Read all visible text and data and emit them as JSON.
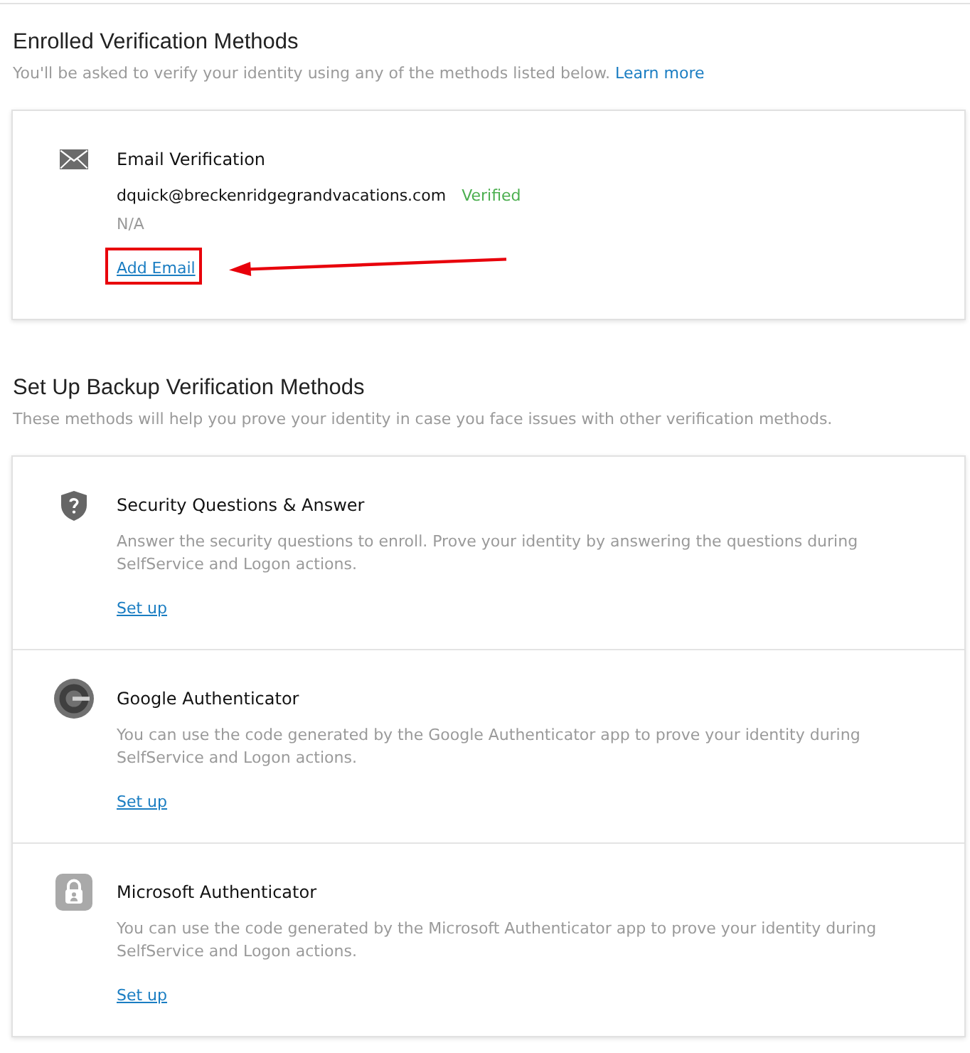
{
  "enrolled": {
    "title": "Enrolled Verification Methods",
    "subtitle": "You'll be asked to verify your identity using any of the methods listed below.",
    "learn_more": "Learn more",
    "methods": [
      {
        "kind": "email",
        "title": "Email Verification",
        "value": "dquick@breckenridgegrandvacations.com",
        "status": "Verified",
        "note": "N/A",
        "action": "Add Email",
        "highlighted": true
      }
    ]
  },
  "backup": {
    "title": "Set Up Backup Verification Methods",
    "subtitle": "These methods will help you prove your identity in case you face issues with other verification methods.",
    "methods": [
      {
        "kind": "security-questions",
        "title": "Security Questions & Answer",
        "description": "Answer the security questions to enroll. Prove your identity by answering the questions during SelfService and Logon actions.",
        "action": "Set up"
      },
      {
        "kind": "google-authenticator",
        "title": "Google Authenticator",
        "description": "You can use the code generated by the Google Authenticator app to prove your identity during SelfService and Logon actions.",
        "action": "Set up"
      },
      {
        "kind": "microsoft-authenticator",
        "title": "Microsoft Authenticator",
        "description": "You can use the code generated by the Microsoft Authenticator app to prove your identity during SelfService and Logon actions.",
        "action": "Set up"
      }
    ]
  }
}
